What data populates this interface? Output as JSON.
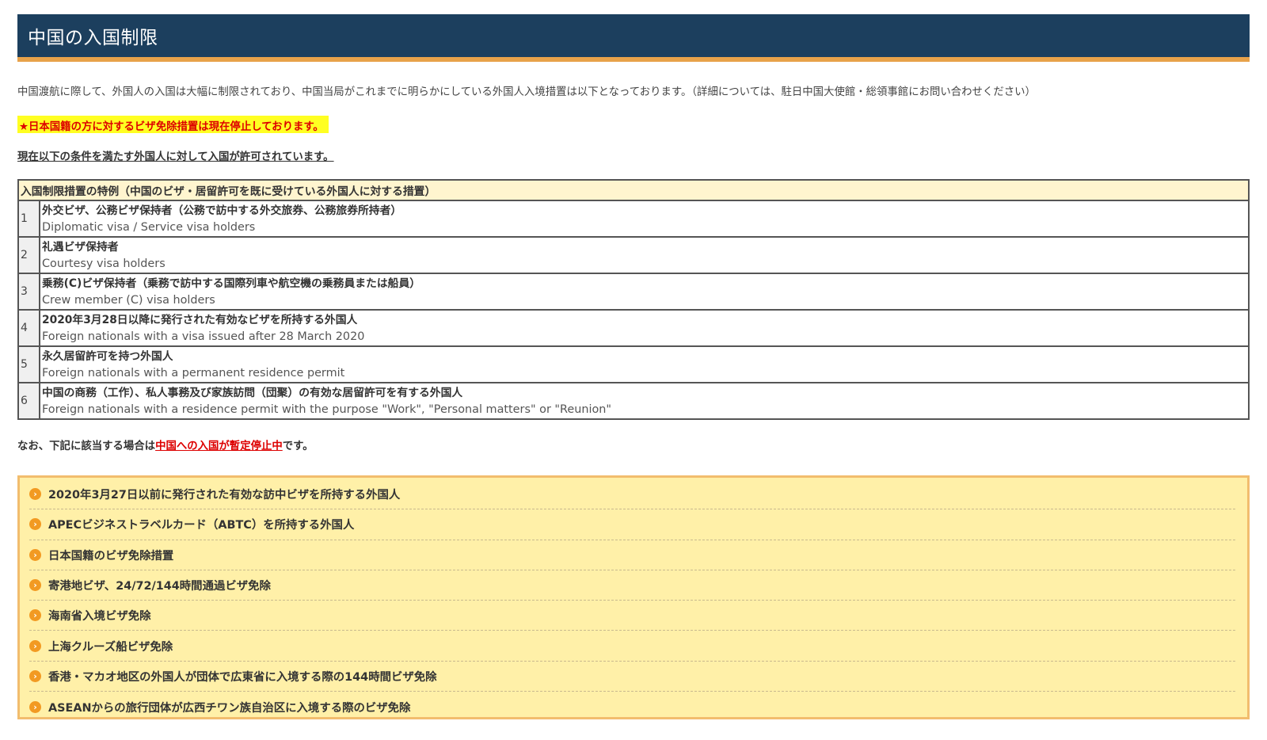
{
  "title": "中国の入国制限",
  "intro": "中国渡航に際して、外国人の入国は大幅に制限されており、中国当局がこれまでに明らかにしている外国人入境措置は以下となっております。（詳細については、駐日中国大使館・総領事館にお問い合わせください）",
  "notice": "★日本国籍の方に対するビザ免除措置は現在停止しております。",
  "conditions_heading": "現在以下の条件を満たす外国人に対して入国が許可されています。",
  "table": {
    "header": "入国制限措置の特例（中国のビザ・居留許可を既に受けている外国人に対する措置）",
    "rows": [
      {
        "num": "1",
        "ja": "外交ビザ、公務ビザ保持者（公務で訪中する外交旅券、公務旅券所持者）",
        "en": "Diplomatic visa / Service visa holders"
      },
      {
        "num": "2",
        "ja": "礼遇ビザ保持者",
        "en": "Courtesy visa holders"
      },
      {
        "num": "3",
        "ja": "乗務(C)ビザ保持者（乗務で訪中する国際列車や航空機の乗務員または船員）",
        "en": "Crew member (C) visa holders"
      },
      {
        "num": "4",
        "ja": "2020年3月28日以降に発行された有効なビザを所持する外国人",
        "en": "Foreign nationals with a visa issued after 28 March 2020"
      },
      {
        "num": "5",
        "ja": "永久居留許可を持つ外国人",
        "en": "Foreign nationals with a permanent residence permit"
      },
      {
        "num": "6",
        "ja": "中国の商務（工作）、私人事務及び家族訪問（団聚）の有効な居留許可を有する外国人",
        "en": "Foreign nationals with a residence permit with the purpose \"Work\", \"Personal matters\" or \"Reunion\""
      }
    ]
  },
  "note": {
    "prefix": "なお、下記に該当する場合は",
    "link": "中国への入国が暫定停止中",
    "suffix": "です。"
  },
  "suspended_items": [
    "2020年3月27日以前に発行された有効な訪中ビザを所持する外国人",
    "APECビジネストラベルカード（ABTC）を所持する外国人",
    "日本国籍のビザ免除措置",
    "寄港地ビザ、24/72/144時間通過ビザ免除",
    "海南省入境ビザ免除",
    "上海クルーズ船ビザ免除",
    "香港・マカオ地区の外国人が団体で広東省に入境する際の144時間ビザ免除",
    "ASEANからの旅行団体が広西チワン族自治区に入境する際のビザ免除"
  ],
  "icons": {
    "bullet": "chevron-right-circle-icon"
  },
  "colors": {
    "header_bg": "#1c3f5e",
    "header_accent": "#e8a24a",
    "notice_bg": "#ffff22",
    "notice_text": "#dd0000",
    "box_bg": "#fff0a8",
    "box_border": "#f2bd6e",
    "bullet": "#f29a22"
  }
}
